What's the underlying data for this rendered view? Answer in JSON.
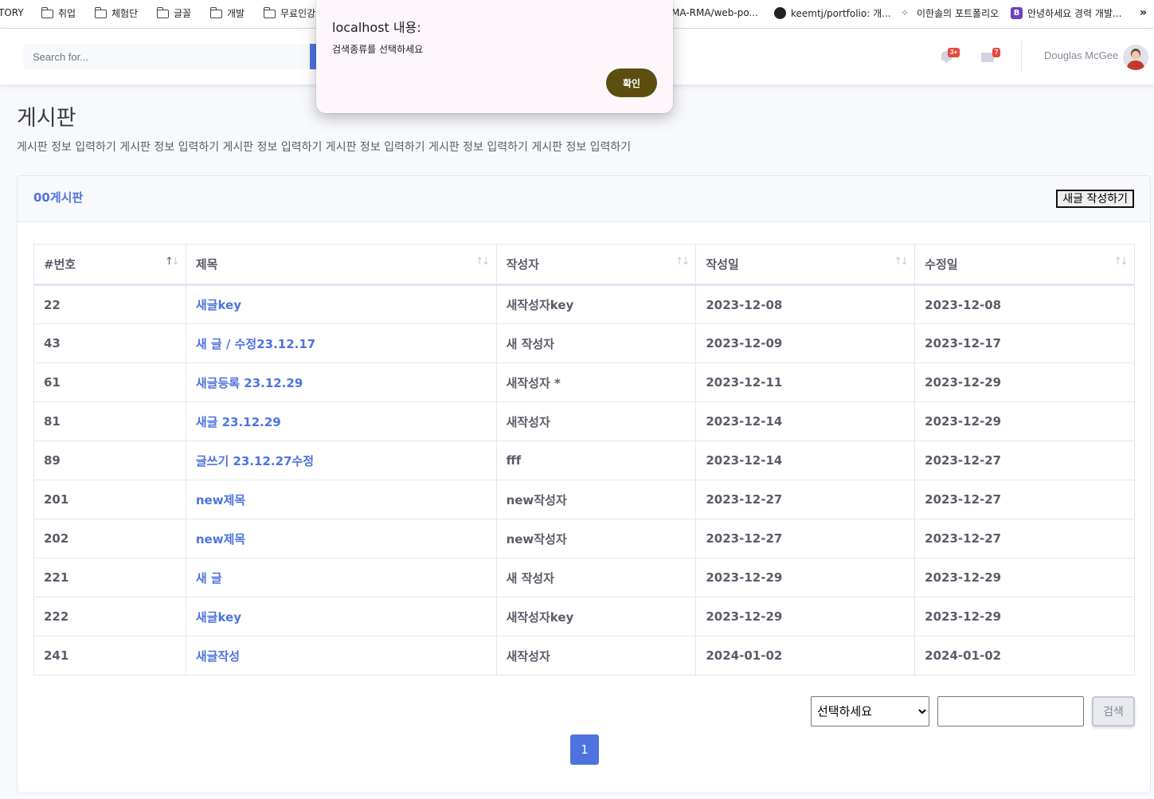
{
  "bookmarks": {
    "items": [
      {
        "label": "TORY",
        "icon": "none"
      },
      {
        "label": "취업",
        "icon": "folder-icon"
      },
      {
        "label": "체험단",
        "icon": "folder-icon"
      },
      {
        "label": "글꼴",
        "icon": "folder-icon"
      },
      {
        "label": "개발",
        "icon": "folder-icon"
      },
      {
        "label": "무료인강",
        "icon": "folder-icon"
      },
      {
        "label": "MA-RMA/web-po...",
        "icon": "none"
      },
      {
        "label": "keemtj/portfolio: 개...",
        "icon": "github-icon"
      },
      {
        "label": "이한솔의 포트폴리오",
        "icon": "runner-icon"
      },
      {
        "label": "안녕하세요 경력 개발...",
        "icon": "bootstrap-icon"
      }
    ],
    "more": "»"
  },
  "topbar": {
    "search_placeholder": "Search for...",
    "alerts_badge": "3+",
    "messages_badge": "7",
    "user_name": "Douglas McGee"
  },
  "page": {
    "title": "게시판",
    "description": "게시판 정보 입력하기 게시판 정보 입력하기 게시판 정보 입력하기 게시판 정보 입력하기 게시판 정보 입력하기 게시판 정보 입력하기"
  },
  "card": {
    "title": "00게시판",
    "new_post_label": "새글 작성하기"
  },
  "table": {
    "columns": [
      "#번호",
      "제목",
      "작성자",
      "작성일",
      "수정일"
    ],
    "rows": [
      {
        "no": "22",
        "title": "새글key",
        "author": "새작성자key",
        "created": "2023-12-08",
        "modified": "2023-12-08"
      },
      {
        "no": "43",
        "title": "새 글 / 수정23.12.17",
        "author": "새 작성자",
        "created": "2023-12-09",
        "modified": "2023-12-17"
      },
      {
        "no": "61",
        "title": "새글등록 23.12.29",
        "author": "새작성자 *",
        "created": "2023-12-11",
        "modified": "2023-12-29"
      },
      {
        "no": "81",
        "title": "새글 23.12.29",
        "author": "새작성자",
        "created": "2023-12-14",
        "modified": "2023-12-29"
      },
      {
        "no": "89",
        "title": "글쓰기 23.12.27수정",
        "author": "fff",
        "created": "2023-12-14",
        "modified": "2023-12-27"
      },
      {
        "no": "201",
        "title": "new제목",
        "author": "new작성자",
        "created": "2023-12-27",
        "modified": "2023-12-27"
      },
      {
        "no": "202",
        "title": "new제목",
        "author": "new작성자",
        "created": "2023-12-27",
        "modified": "2023-12-27"
      },
      {
        "no": "221",
        "title": "새 글",
        "author": "새 작성자",
        "created": "2023-12-29",
        "modified": "2023-12-29"
      },
      {
        "no": "222",
        "title": "새글key",
        "author": "새작성자key",
        "created": "2023-12-29",
        "modified": "2023-12-29"
      },
      {
        "no": "241",
        "title": "새글작성",
        "author": "새작성자",
        "created": "2024-01-02",
        "modified": "2024-01-02"
      }
    ]
  },
  "search": {
    "select_value": "선택하세요",
    "text_value": "",
    "submit_label": "검색"
  },
  "pagination": {
    "current_page": "1"
  },
  "dialog": {
    "title": "localhost 내용:",
    "message": "검색종류를 선택하세요",
    "ok_label": "확인"
  },
  "colors": {
    "primary": "#4e73df",
    "danger": "#e74a3b",
    "dialog_button": "#5b4e0e"
  }
}
